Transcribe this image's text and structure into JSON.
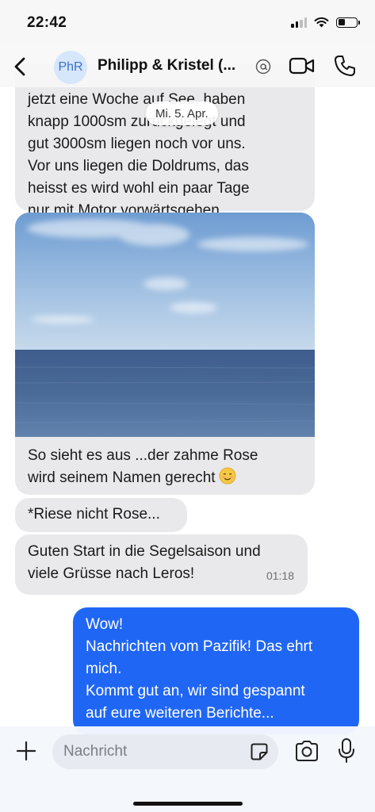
{
  "status_bar": {
    "time": "22:42"
  },
  "header": {
    "back_icon": "chevron-left-icon",
    "avatar_initials": "PhR",
    "title": "Philipp & Kristel (...",
    "video_icon": "video-camera-icon",
    "call_icon": "phone-icon"
  },
  "date_separator": "Mi. 5. Apr.",
  "messages": [
    {
      "direction": "incoming",
      "text": "jetzt eine Woche auf See, haben\nknapp 1000sm zurückgelegt und\ngut 3000sm liegen noch vor uns.\nVor uns liegen die Doldrums, das\nheisst es wird wohl ein paar Tage\nnur mit Motor vorwärtsgehen."
    },
    {
      "direction": "incoming",
      "has_photo": true,
      "photo_subject": "ocean-horizon",
      "text": "So sieht es aus ...der zahme Rose\nwird seinem Namen gerecht",
      "emoji": "smiling-face-emoji"
    },
    {
      "direction": "incoming",
      "text": "*Riese nicht Rose..."
    },
    {
      "direction": "incoming",
      "text": "Guten Start in die Segelsaison und\nviele Grüsse nach Leros!",
      "time": "01:18"
    },
    {
      "direction": "outgoing",
      "text": "Wow!\nNachrichten vom Pazifik! Das ehrt\nmich.\nKommt gut an, wir sind gespannt\nauf eure weiteren Berichte..."
    }
  ],
  "composer": {
    "placeholder": "Nachricht",
    "value": ""
  },
  "colors": {
    "outgoing_bubble": "#2066f5",
    "incoming_bubble": "#e9e9eb",
    "avatar_bg": "#d6e6fb"
  }
}
